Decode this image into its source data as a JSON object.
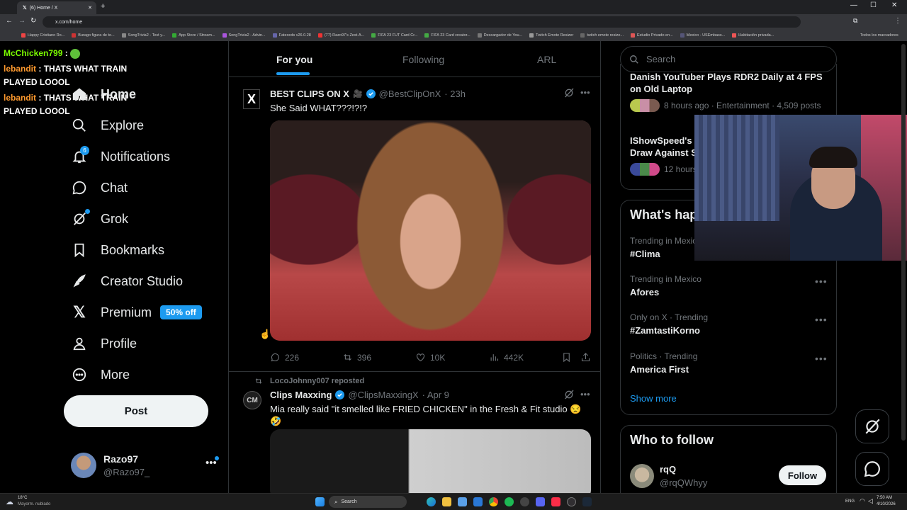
{
  "browser": {
    "tab_title": "(6) Home / X",
    "url": "x.com/home",
    "bookmarks": [
      "Happy Cristiano Ro...",
      "Burago figura de to...",
      "SongTrivia2 - Test y...",
      "App Store / Stream...",
      "SongTrivia2 - Advin...",
      "Fateocds v26.0.28",
      "(77) Razo97's Zest-A...",
      "FIFA 23 FUT Card Cr...",
      "FIFA 23 Card creator...",
      "Descargador de You...",
      "Twitch Emote Resizer",
      "twitch emote resize...",
      "Estudio Privado en...",
      "Mexico - USEmbass...",
      "Habitación privada..."
    ],
    "bookmarks_all": "Todos los marcadores"
  },
  "chat": [
    {
      "user": "McChicken799",
      "sep": " : ",
      "msg": "",
      "user_color": "#7cfc00"
    },
    {
      "user": "lebandit",
      "sep": " : ",
      "msg": "THATS WHAT TRAIN PLAYED LOOOL",
      "user_color": "#ff9a2e"
    },
    {
      "user": "lebandit",
      "sep": " : ",
      "msg": "THATS WHAT TRAIN PLAYED LOOOL",
      "user_color": "#ff9a2e"
    }
  ],
  "nav": {
    "home": "Home",
    "explore": "Explore",
    "notifications": "Notifications",
    "notifications_count": "6",
    "chat": "Chat",
    "grok": "Grok",
    "bookmarks": "Bookmarks",
    "creator_studio": "Creator Studio",
    "premium": "Premium",
    "premium_badge": "50% off",
    "profile": "Profile",
    "more": "More",
    "post": "Post",
    "user_name": "Razo97",
    "user_handle": "@Razo97_"
  },
  "tabs": [
    "For you",
    "Following",
    "ARL"
  ],
  "tweets": [
    {
      "author": "BEST CLIPS ON X",
      "handle": "@BestClipOnX",
      "time": "· 23h",
      "text": "She Said WHAT???!?!?",
      "replies": "226",
      "reposts": "396",
      "likes": "10K",
      "views": "442K",
      "avatar_text": "X"
    },
    {
      "reposted_by": "LocoJohnny007 reposted",
      "author": "Clips Maxxing",
      "handle": "@ClipsMaxxingX",
      "time": "· Apr 9",
      "text": "Mia really said \"it smelled like FRIED CHICKEN\" in the Fresh & Fit studio 😒",
      "text2": "🤣",
      "avatar_text": "CM"
    }
  ],
  "search": {
    "placeholder": "Search"
  },
  "news": [
    {
      "title": "Danish YouTuber Plays RDR2 Daily at 4 FPS on Old Laptop",
      "meta": "8 hours ago · Entertainment · 4,509 posts"
    },
    {
      "title": "IShowSpeed's",
      "title2": "Draw Against S",
      "meta": "12 hours"
    }
  ],
  "happening": {
    "title": "What's hap",
    "trends": [
      {
        "meta": "Trending in Mexico",
        "name": "#Clima"
      },
      {
        "meta": "Trending in Mexico",
        "name": "Afores"
      },
      {
        "meta": "Only on X · Trending",
        "name": "#ZamtastiKorno"
      },
      {
        "meta": "Politics · Trending",
        "name": "America First"
      }
    ],
    "show_more": "Show more"
  },
  "who_to_follow": {
    "title": "Who to follow",
    "name": "rqQ",
    "handle": "@rqQWhyy",
    "follow": "Follow"
  },
  "taskbar": {
    "weather_temp": "18°C",
    "weather_desc": "Mayorm. nublado",
    "search": "Search",
    "lang": "ENG",
    "time": "7:50 AM",
    "date": "4/10/2026"
  },
  "colors": {
    "accent": "#1d9bf0",
    "bg": "#000000",
    "border": "#2f3336",
    "muted": "#71767b"
  }
}
